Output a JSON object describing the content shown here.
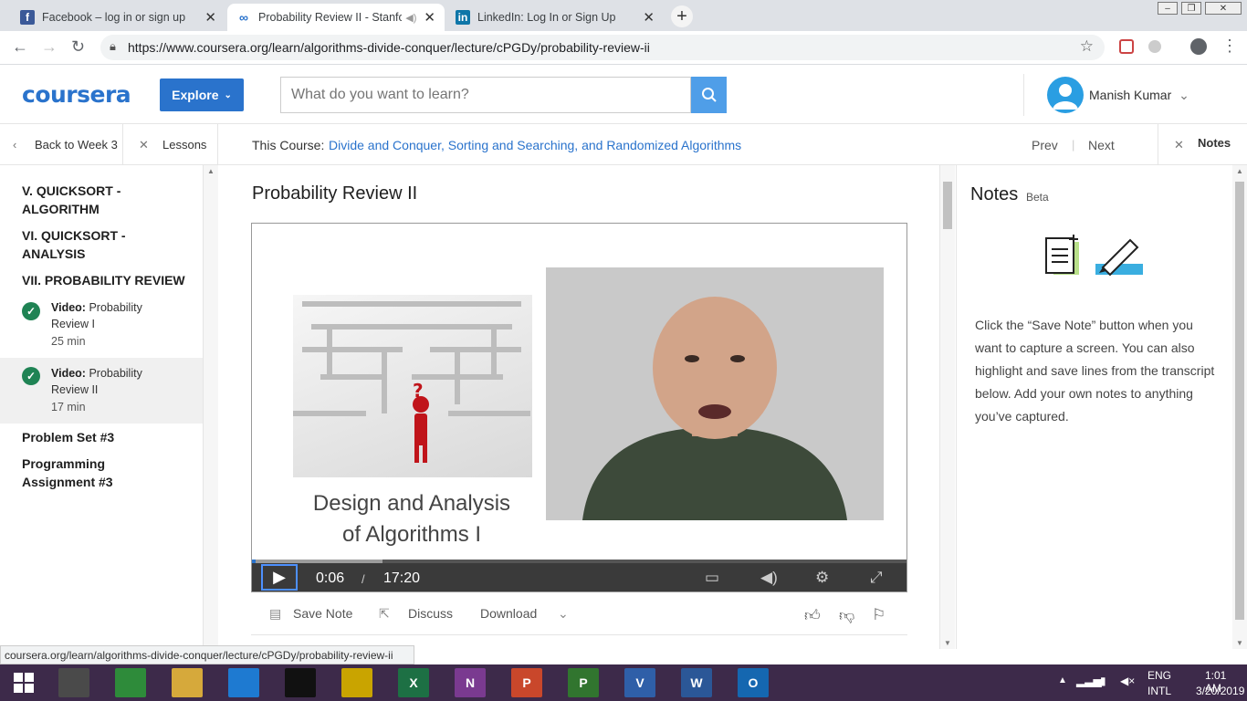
{
  "browser": {
    "tabs": [
      {
        "title": "Facebook – log in or sign up",
        "icon": "facebook-icon",
        "color": "#3b5998"
      },
      {
        "title": "Probability Review II - Stanfo",
        "icon": "coursera-icon",
        "color": "#2a73cc"
      },
      {
        "title": "LinkedIn: Log In or Sign Up",
        "icon": "linkedin-icon",
        "color": "#0e76a8"
      }
    ],
    "url": "https://www.coursera.org/learn/algorithms-divide-conquer/lecture/cPGDy/probability-review-ii",
    "status_url": "coursera.org/learn/algorithms-divide-conquer/lecture/cPGDy/probability-review-ii"
  },
  "header": {
    "logo": "coursera",
    "explore_label": "Explore",
    "search_placeholder": "What do you want to learn?",
    "user_name": "Manish Kumar"
  },
  "course_nav": {
    "back_label": "Back to Week 3",
    "lessons_label": "Lessons",
    "course_prefix": "This Course:",
    "course_title": "Divide and Conquer, Sorting and Searching, and Randomized Algorithms",
    "prev_label": "Prev",
    "next_label": "Next",
    "notes_label": "Notes"
  },
  "sidebar": {
    "sections": [
      {
        "line1": "V. QUICKSORT -",
        "line2": "ALGORITHM"
      },
      {
        "line1": "VI. QUICKSORT -",
        "line2": "ANALYSIS"
      },
      {
        "line1": "VII. PROBABILITY REVIEW",
        "line2": ""
      }
    ],
    "items": [
      {
        "kind": "Video:",
        "title1": "Probability",
        "title2": "Review I",
        "duration": "25 min"
      },
      {
        "kind": "Video:",
        "title1": "Probability",
        "title2": "Review II",
        "duration": "17 min"
      }
    ],
    "footer": [
      {
        "line1": "Problem Set #3",
        "line2": ""
      },
      {
        "line1": "Programming",
        "line2": "Assignment #3"
      }
    ]
  },
  "lecture": {
    "title": "Probability Review II",
    "slide_line1": "Design and Analysis",
    "slide_line2": "of Algorithms I",
    "current_time": "0:06",
    "separator": "/",
    "total_time": "17:20",
    "progress_fraction": 0.006,
    "buffered_fraction": 0.2
  },
  "actions": {
    "save_note": "Save Note",
    "discuss": "Discuss",
    "download": "Download"
  },
  "notes": {
    "title": "Notes",
    "badge": "Beta",
    "text": "Click the “Save Note” button when you want to capture a screen. You can also highlight and save lines from the transcript below. Add your own notes to anything you’ve captured."
  },
  "taskbar": {
    "lang1": "ENG",
    "lang2": "INTL",
    "time": "1:01 AM",
    "date": "3/20/2019",
    "apps": [
      {
        "name": "chrome-icon",
        "color": "#4a4a4a"
      },
      {
        "name": "store-icon",
        "color": "#2e8b3a"
      },
      {
        "name": "file-explorer-icon",
        "color": "#d6a93b"
      },
      {
        "name": "internet-explorer-icon",
        "color": "#1e7ad1"
      },
      {
        "name": "cmd-icon",
        "color": "#111111"
      },
      {
        "name": "app-icon",
        "color": "#c9a400"
      },
      {
        "name": "excel-icon",
        "color": "#1d7044",
        "letter": "X"
      },
      {
        "name": "onenote-icon",
        "color": "#7a3a90",
        "letter": "N"
      },
      {
        "name": "powerpoint-icon",
        "color": "#c9472b",
        "letter": "P"
      },
      {
        "name": "project-icon",
        "color": "#31752f",
        "letter": "P"
      },
      {
        "name": "visio-icon",
        "color": "#2f5fa8",
        "letter": "V"
      },
      {
        "name": "word-icon",
        "color": "#2b5797",
        "letter": "W"
      },
      {
        "name": "outlook-icon",
        "color": "#1567b0",
        "letter": "O"
      }
    ]
  }
}
